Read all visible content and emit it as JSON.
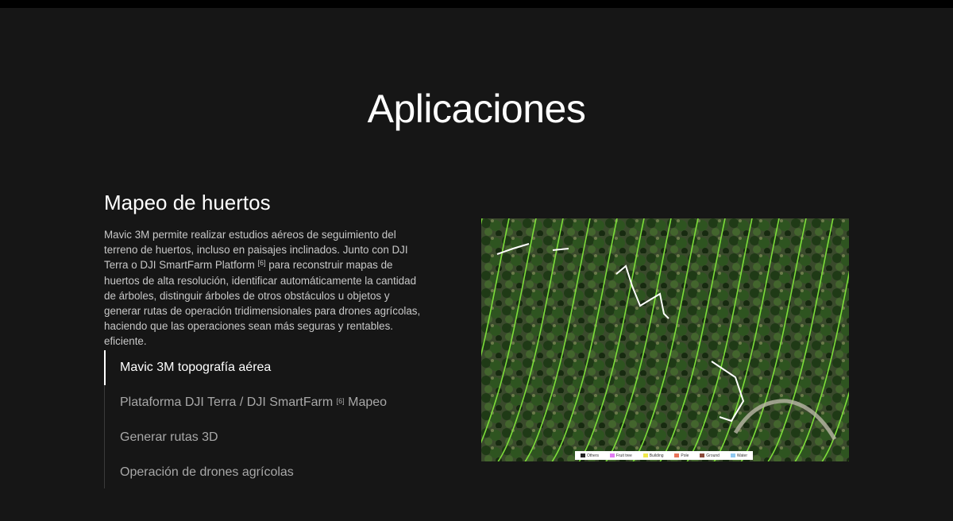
{
  "page": {
    "title": "Aplicaciones"
  },
  "section": {
    "title": "Mapeo de huertos",
    "description_parts": [
      "Mavic 3M permite realizar estudios aéreos de seguimiento del terreno de huertos, incluso en paisajes inclinados. Junto con DJI Terra o DJI SmartFarm Platform ",
      "[6]",
      " para reconstruir mapas de huertos de alta resolución, identificar automáticamente la cantidad de árboles, distinguir árboles de otros obstáculos u objetos y generar rutas de operación tridimensionales para drones agrícolas, haciendo que las operaciones sean más seguras y rentables. eficiente."
    ]
  },
  "tabs": [
    {
      "label": "Mavic 3M topografía aérea",
      "active": true
    },
    {
      "label_before": "Plataforma DJI Terra / DJI SmartFarm ",
      "sup": "[6]",
      "label_after": " Mapeo",
      "active": false
    },
    {
      "label": "Generar rutas 3D",
      "active": false
    },
    {
      "label": "Operación de drones agrícolas",
      "active": false
    }
  ],
  "map_legend": [
    {
      "label": "Others",
      "color": "#222222"
    },
    {
      "label": "Fruit tree",
      "color": "#e07bf2"
    },
    {
      "label": "Building",
      "color": "#f0e84a"
    },
    {
      "label": "Pole",
      "color": "#e8735a"
    },
    {
      "label": "Ground",
      "color": "#8a4a3a"
    },
    {
      "label": "Water",
      "color": "#8ec8f0"
    }
  ],
  "colors": {
    "background": "#161616",
    "route_lines": "#7dde3a",
    "path_lines": "#ffffff"
  }
}
